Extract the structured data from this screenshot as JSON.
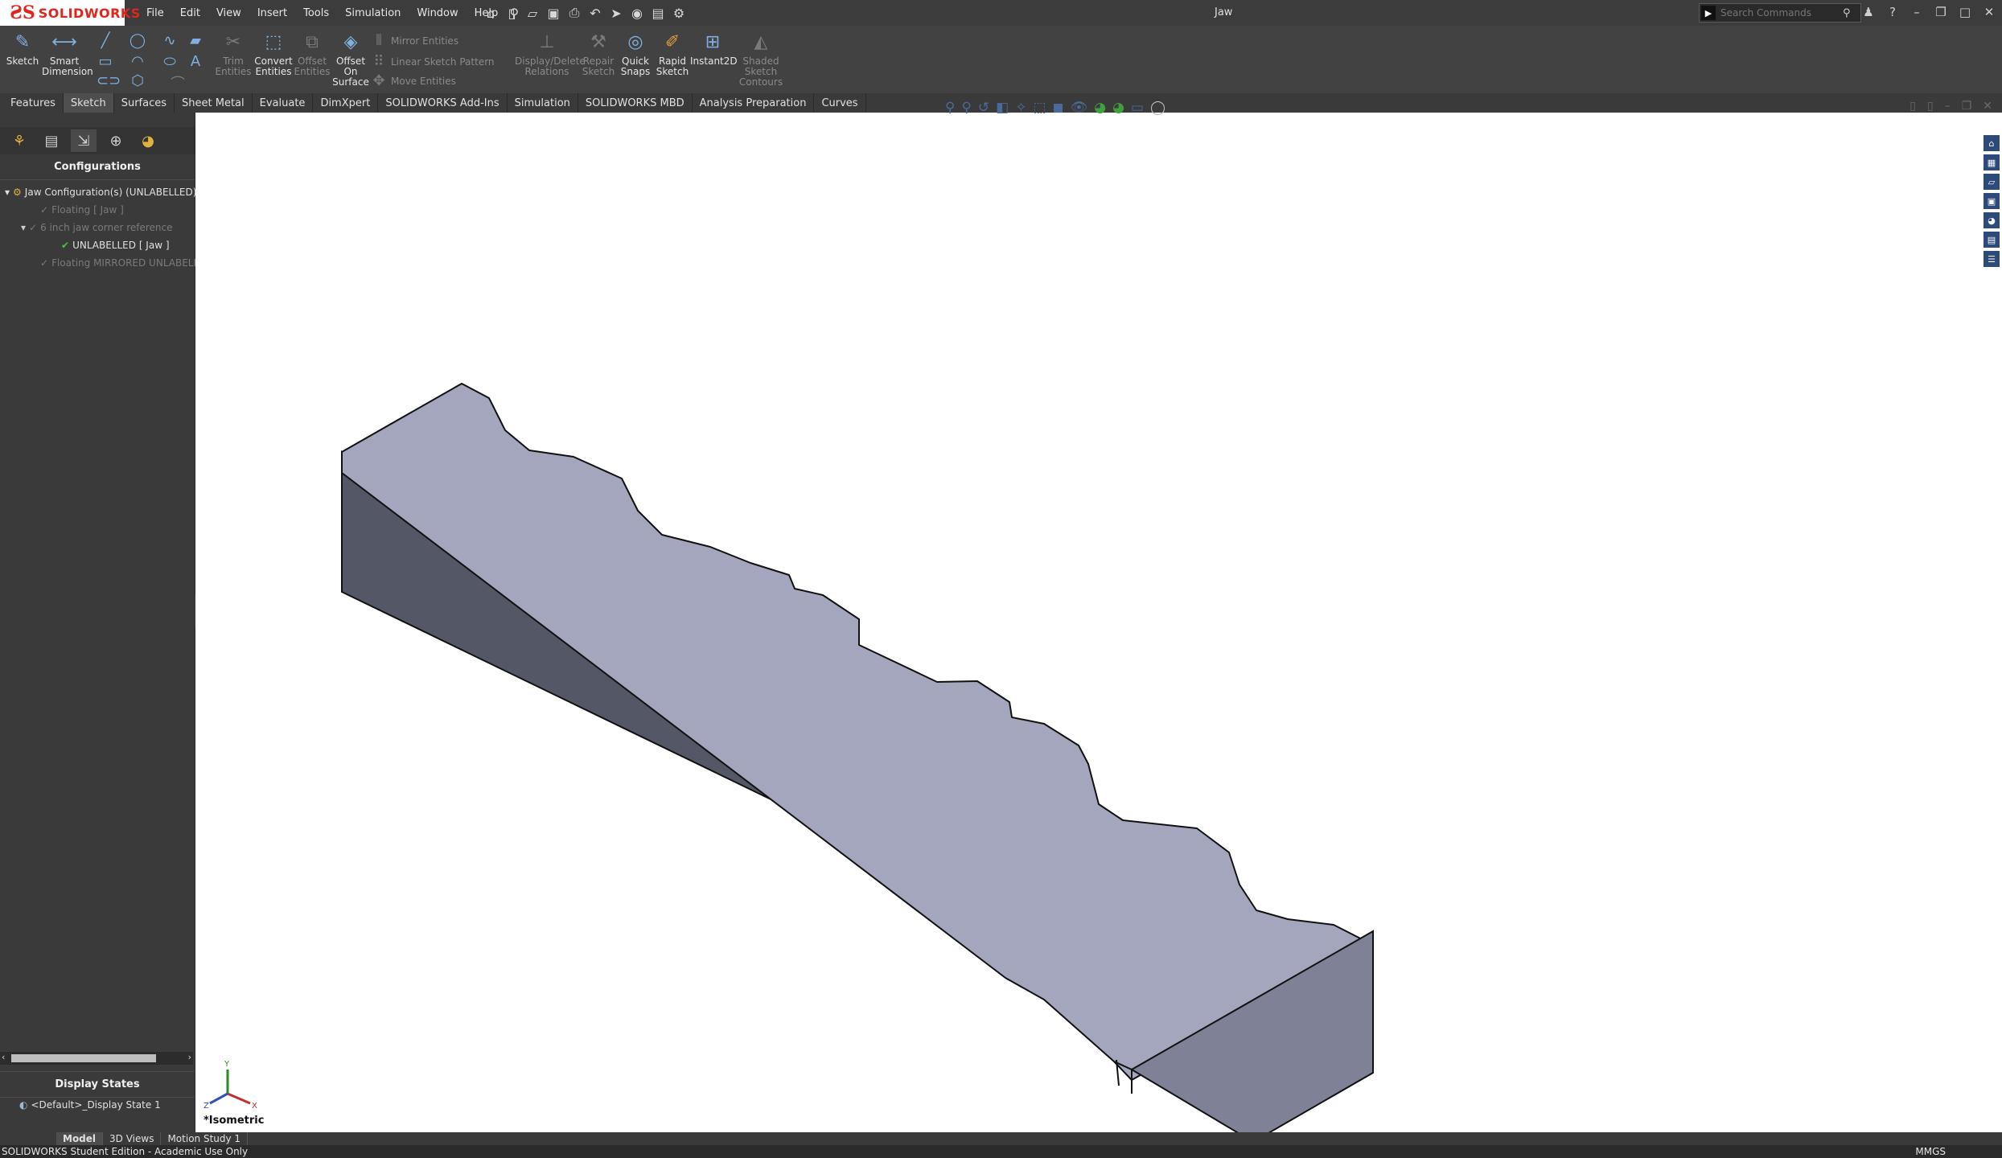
{
  "app": {
    "brand": "SOLIDWORKS",
    "document_title": "Jaw"
  },
  "menu": [
    "File",
    "Edit",
    "View",
    "Insert",
    "Tools",
    "Simulation",
    "Window",
    "Help"
  ],
  "search": {
    "placeholder": "Search Commands"
  },
  "ribbon": {
    "sketch": "Sketch",
    "smart_dimension": "Smart Dimension",
    "trim_entities": "Trim Entities",
    "convert_entities": "Convert Entities",
    "offset_entities": "Offset Entities",
    "offset_on_surface": "Offset On Surface",
    "mirror_entities": "Mirror Entities",
    "linear_sketch_pattern": "Linear Sketch Pattern",
    "move_entities": "Move Entities",
    "display_delete_relations": "Display/Delete Relations",
    "repair_sketch": "Repair Sketch",
    "quick_snaps": "Quick Snaps",
    "rapid_sketch": "Rapid Sketch",
    "instant2d": "Instant2D",
    "shaded_sketch_contours": "Shaded Sketch Contours"
  },
  "tabs": [
    "Features",
    "Sketch",
    "Surfaces",
    "Sheet Metal",
    "Evaluate",
    "DimXpert",
    "SOLIDWORKS Add-Ins",
    "Simulation",
    "SOLIDWORKS MBD",
    "Analysis Preparation",
    "Curves"
  ],
  "active_tab": "Sketch",
  "left_panel": {
    "title": "Configurations",
    "tree": [
      {
        "label": "Jaw Configuration(s)  (UNLABELLED)",
        "dim": false
      },
      {
        "label": "Floating [ Jaw ]",
        "dim": true
      },
      {
        "label": "6 inch jaw corner reference",
        "dim": true
      },
      {
        "label": "UNLABELLED [ Jaw ]",
        "dim": false
      },
      {
        "label": "Floating MIRRORED UNLABELLED",
        "dim": true
      }
    ],
    "display_states_title": "Display States",
    "display_state_item": "<Default>_Display State 1"
  },
  "viewport": {
    "view_name": "*Isometric"
  },
  "bottom_tabs": [
    "Model",
    "3D Views",
    "Motion Study 1"
  ],
  "active_bottom_tab": "Model",
  "status": {
    "message": "SOLIDWORKS Student Edition - Academic Use Only",
    "units": "MMGS"
  },
  "colors": {
    "model_top": "#a3a6bc",
    "model_side": "#545766",
    "model_end": "#7f8296",
    "ui_dark": "#3c3c3c",
    "brand_red": "#e1251b"
  }
}
